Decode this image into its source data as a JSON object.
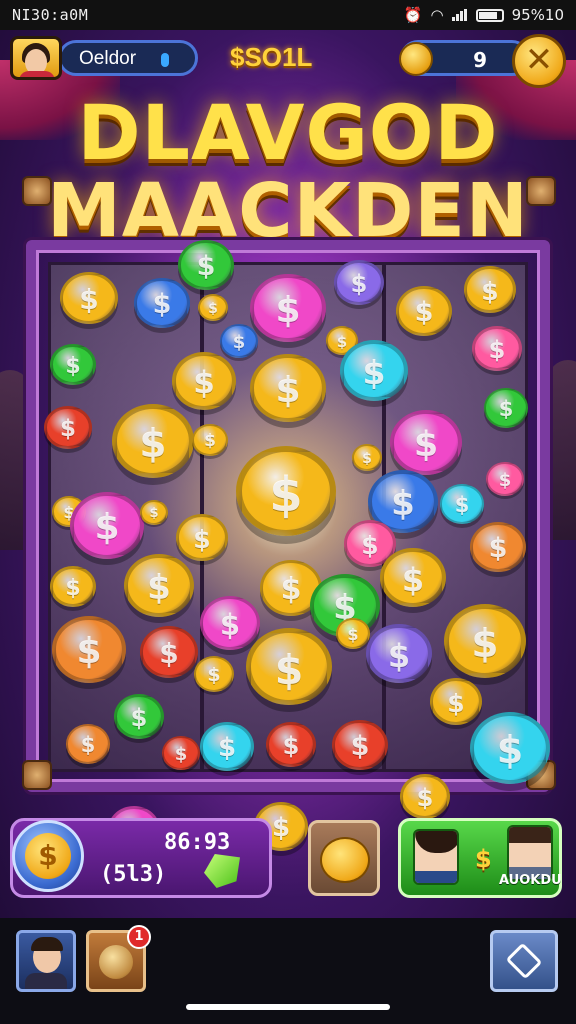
{
  "status_bar": {
    "time": "NI30:a0M",
    "right_text": "95%10"
  },
  "hud": {
    "player_name": "Oeldor",
    "money": "$SO1L",
    "coin_count": "9",
    "close_symbol": "✕"
  },
  "title": {
    "line1": "DLAVGOD",
    "line2": "MAACKDEN"
  },
  "bank": {
    "value": "86:93",
    "sub": "(5l3)",
    "coin_symbol": "$"
  },
  "friends": {
    "dollar": "$",
    "label": "AUOKDU"
  },
  "nav": {
    "badge": "1"
  },
  "coins": [
    {
      "color": "gold",
      "symbol": "$"
    },
    {
      "color": "blue",
      "symbol": "$"
    },
    {
      "color": "green",
      "symbol": "$"
    },
    {
      "color": "magenta",
      "symbol": "$"
    },
    {
      "color": "purple",
      "symbol": "$"
    },
    {
      "color": "gold",
      "symbol": "$"
    },
    {
      "color": "pink",
      "symbol": "$"
    },
    {
      "color": "green",
      "symbol": "$"
    },
    {
      "color": "cyan",
      "symbol": "$"
    },
    {
      "color": "red",
      "symbol": "$"
    },
    {
      "color": "gold",
      "symbol": "$"
    }
  ],
  "colors": {
    "gold": "#f5b81a",
    "blue": "#3a7ae8",
    "green": "#32c83a",
    "magenta": "#f048c8",
    "purple": "#8a6ae8",
    "pink": "#ff5aa0",
    "cyan": "#34d4ee",
    "red": "#e8402a",
    "orange": "#f08830"
  }
}
